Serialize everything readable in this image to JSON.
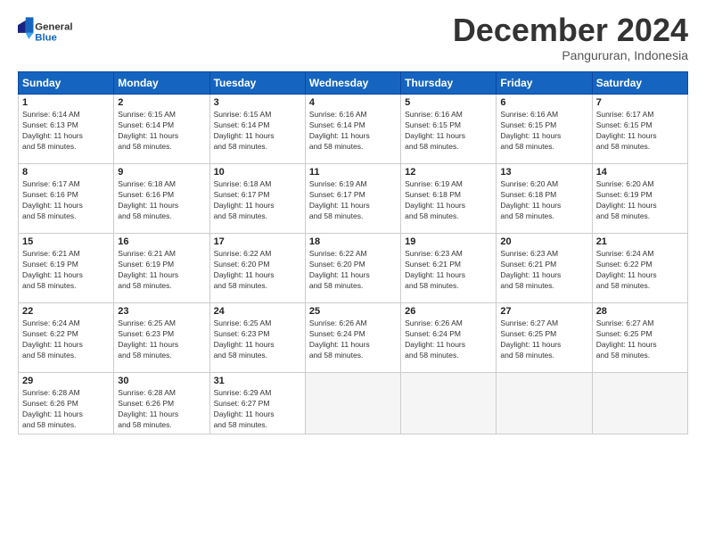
{
  "header": {
    "logo_line1": "General",
    "logo_line2": "Blue",
    "month": "December 2024",
    "location": "Pangururan, Indonesia"
  },
  "weekdays": [
    "Sunday",
    "Monday",
    "Tuesday",
    "Wednesday",
    "Thursday",
    "Friday",
    "Saturday"
  ],
  "weeks": [
    [
      {
        "day": "1",
        "info": "Sunrise: 6:14 AM\nSunset: 6:13 PM\nDaylight: 11 hours\nand 58 minutes."
      },
      {
        "day": "2",
        "info": "Sunrise: 6:15 AM\nSunset: 6:14 PM\nDaylight: 11 hours\nand 58 minutes."
      },
      {
        "day": "3",
        "info": "Sunrise: 6:15 AM\nSunset: 6:14 PM\nDaylight: 11 hours\nand 58 minutes."
      },
      {
        "day": "4",
        "info": "Sunrise: 6:16 AM\nSunset: 6:14 PM\nDaylight: 11 hours\nand 58 minutes."
      },
      {
        "day": "5",
        "info": "Sunrise: 6:16 AM\nSunset: 6:15 PM\nDaylight: 11 hours\nand 58 minutes."
      },
      {
        "day": "6",
        "info": "Sunrise: 6:16 AM\nSunset: 6:15 PM\nDaylight: 11 hours\nand 58 minutes."
      },
      {
        "day": "7",
        "info": "Sunrise: 6:17 AM\nSunset: 6:15 PM\nDaylight: 11 hours\nand 58 minutes."
      }
    ],
    [
      {
        "day": "8",
        "info": "Sunrise: 6:17 AM\nSunset: 6:16 PM\nDaylight: 11 hours\nand 58 minutes."
      },
      {
        "day": "9",
        "info": "Sunrise: 6:18 AM\nSunset: 6:16 PM\nDaylight: 11 hours\nand 58 minutes."
      },
      {
        "day": "10",
        "info": "Sunrise: 6:18 AM\nSunset: 6:17 PM\nDaylight: 11 hours\nand 58 minutes."
      },
      {
        "day": "11",
        "info": "Sunrise: 6:19 AM\nSunset: 6:17 PM\nDaylight: 11 hours\nand 58 minutes."
      },
      {
        "day": "12",
        "info": "Sunrise: 6:19 AM\nSunset: 6:18 PM\nDaylight: 11 hours\nand 58 minutes."
      },
      {
        "day": "13",
        "info": "Sunrise: 6:20 AM\nSunset: 6:18 PM\nDaylight: 11 hours\nand 58 minutes."
      },
      {
        "day": "14",
        "info": "Sunrise: 6:20 AM\nSunset: 6:19 PM\nDaylight: 11 hours\nand 58 minutes."
      }
    ],
    [
      {
        "day": "15",
        "info": "Sunrise: 6:21 AM\nSunset: 6:19 PM\nDaylight: 11 hours\nand 58 minutes."
      },
      {
        "day": "16",
        "info": "Sunrise: 6:21 AM\nSunset: 6:19 PM\nDaylight: 11 hours\nand 58 minutes."
      },
      {
        "day": "17",
        "info": "Sunrise: 6:22 AM\nSunset: 6:20 PM\nDaylight: 11 hours\nand 58 minutes."
      },
      {
        "day": "18",
        "info": "Sunrise: 6:22 AM\nSunset: 6:20 PM\nDaylight: 11 hours\nand 58 minutes."
      },
      {
        "day": "19",
        "info": "Sunrise: 6:23 AM\nSunset: 6:21 PM\nDaylight: 11 hours\nand 58 minutes."
      },
      {
        "day": "20",
        "info": "Sunrise: 6:23 AM\nSunset: 6:21 PM\nDaylight: 11 hours\nand 58 minutes."
      },
      {
        "day": "21",
        "info": "Sunrise: 6:24 AM\nSunset: 6:22 PM\nDaylight: 11 hours\nand 58 minutes."
      }
    ],
    [
      {
        "day": "22",
        "info": "Sunrise: 6:24 AM\nSunset: 6:22 PM\nDaylight: 11 hours\nand 58 minutes."
      },
      {
        "day": "23",
        "info": "Sunrise: 6:25 AM\nSunset: 6:23 PM\nDaylight: 11 hours\nand 58 minutes."
      },
      {
        "day": "24",
        "info": "Sunrise: 6:25 AM\nSunset: 6:23 PM\nDaylight: 11 hours\nand 58 minutes."
      },
      {
        "day": "25",
        "info": "Sunrise: 6:26 AM\nSunset: 6:24 PM\nDaylight: 11 hours\nand 58 minutes."
      },
      {
        "day": "26",
        "info": "Sunrise: 6:26 AM\nSunset: 6:24 PM\nDaylight: 11 hours\nand 58 minutes."
      },
      {
        "day": "27",
        "info": "Sunrise: 6:27 AM\nSunset: 6:25 PM\nDaylight: 11 hours\nand 58 minutes."
      },
      {
        "day": "28",
        "info": "Sunrise: 6:27 AM\nSunset: 6:25 PM\nDaylight: 11 hours\nand 58 minutes."
      }
    ],
    [
      {
        "day": "29",
        "info": "Sunrise: 6:28 AM\nSunset: 6:26 PM\nDaylight: 11 hours\nand 58 minutes."
      },
      {
        "day": "30",
        "info": "Sunrise: 6:28 AM\nSunset: 6:26 PM\nDaylight: 11 hours\nand 58 minutes."
      },
      {
        "day": "31",
        "info": "Sunrise: 6:29 AM\nSunset: 6:27 PM\nDaylight: 11 hours\nand 58 minutes."
      },
      {
        "day": "",
        "info": ""
      },
      {
        "day": "",
        "info": ""
      },
      {
        "day": "",
        "info": ""
      },
      {
        "day": "",
        "info": ""
      }
    ]
  ]
}
